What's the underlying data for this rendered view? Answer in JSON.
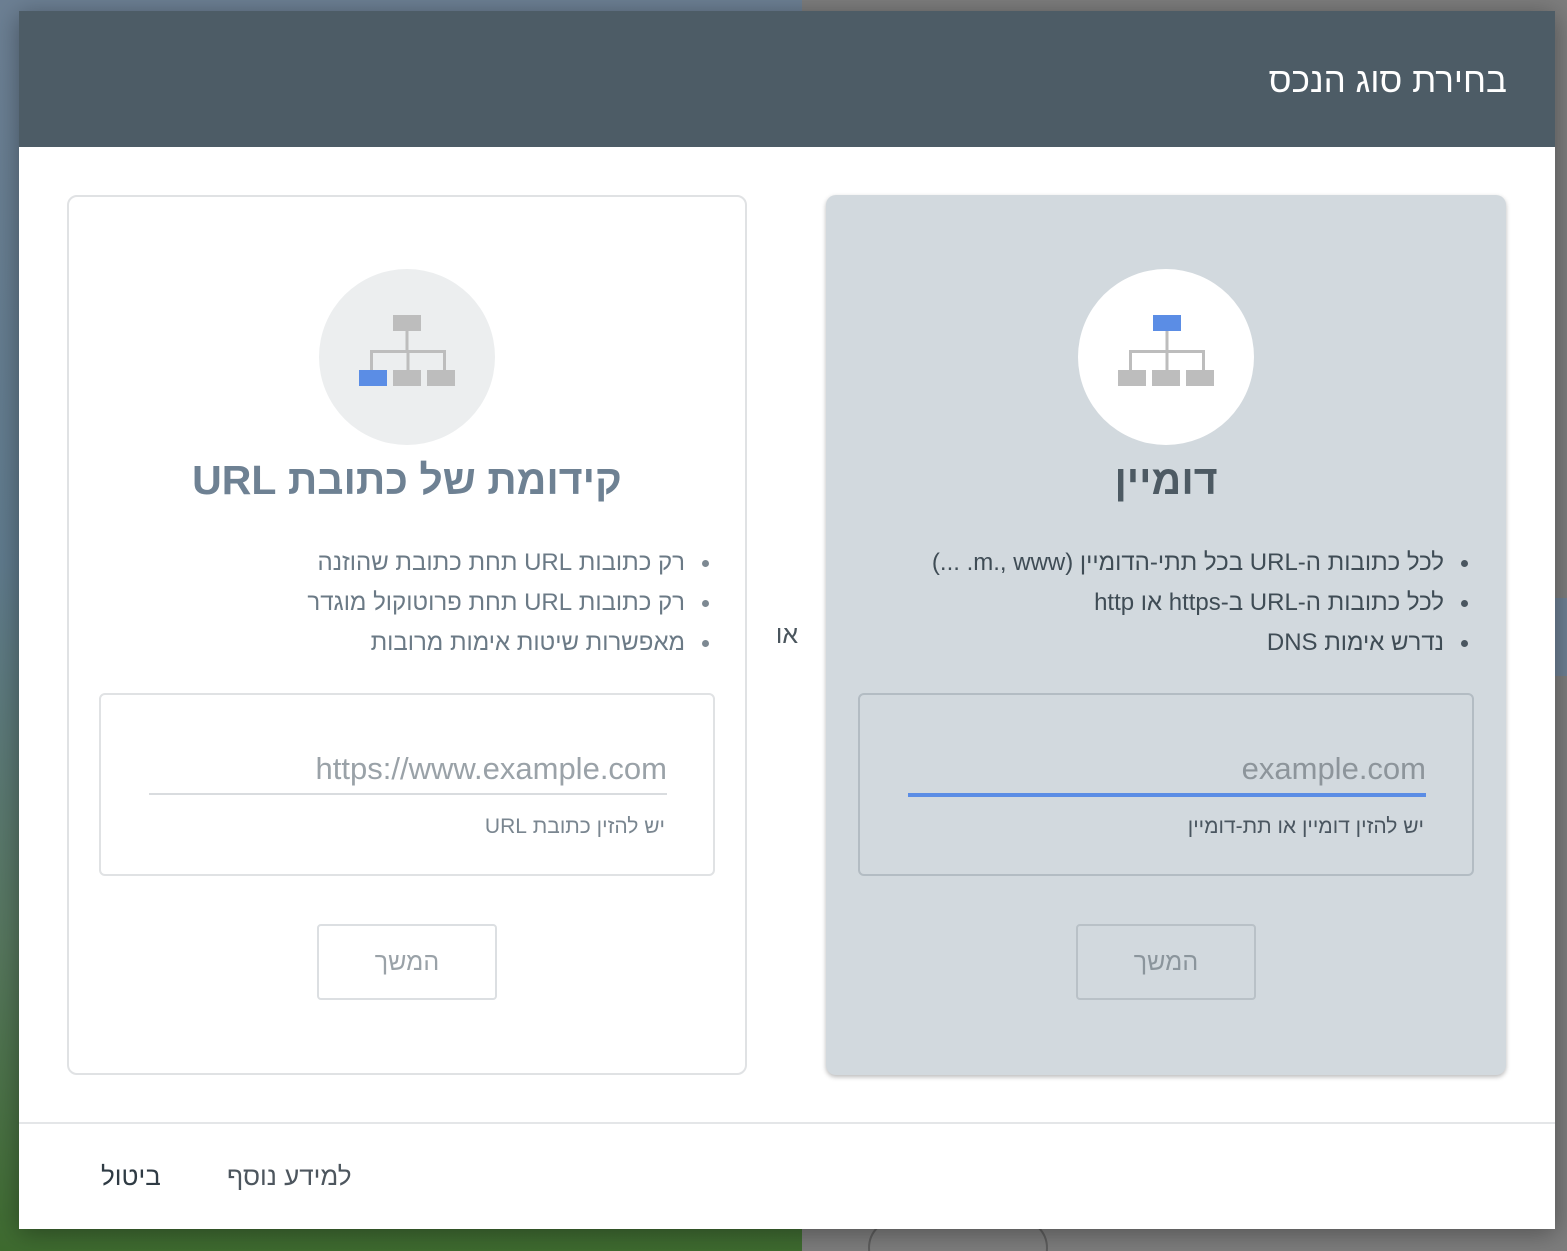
{
  "dialog": {
    "title": "בחירת סוג הנכס",
    "or_label": "או"
  },
  "domain_card": {
    "icon": "sitemap-icon-root-highlighted",
    "heading": "דומיין",
    "bullets": [
      "לכל כתובות ה-URL בכל תתי-הדומיין (m., www. ...)",
      "לכל כתובות ה-URL ב-https או http",
      "נדרש אימות DNS"
    ],
    "input": {
      "value": "",
      "placeholder": "example.com",
      "helper": "יש להזין דומיין או תת-דומיין"
    },
    "continue_label": "המשך"
  },
  "url_prefix_card": {
    "icon": "sitemap-icon-leaf-highlighted",
    "heading": "קידומת של כתובת URL",
    "bullets": [
      "רק כתובות URL תחת כתובת שהוזנה",
      "רק כתובות URL תחת פרוטוקול מוגדר",
      "מאפשרות שיטות אימות מרובות"
    ],
    "input": {
      "value": "",
      "placeholder": "https://www.example.com",
      "helper": "יש להזין כתובת URL"
    },
    "continue_label": "המשך"
  },
  "footer": {
    "learn_more_label": "למידע נוסף",
    "cancel_label": "ביטול"
  },
  "colors": {
    "header_bg": "#4d5c66",
    "selected_card_bg": "#d2d9de",
    "accent_blue": "#5b8de5",
    "icon_gray": "#bdbdbd"
  }
}
